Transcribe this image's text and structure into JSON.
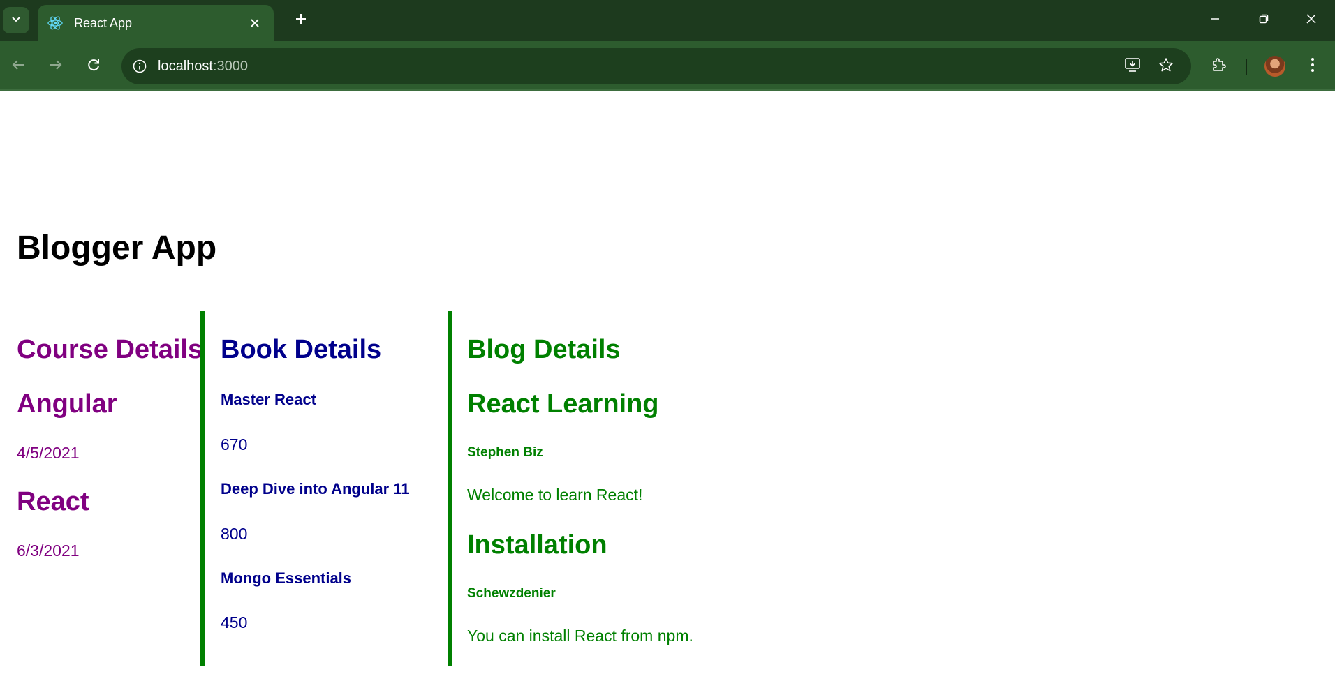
{
  "browser": {
    "tab_title": "React App",
    "url_host": "localhost",
    "url_port": ":3000"
  },
  "app": {
    "title": "Blogger App"
  },
  "course": {
    "heading": "Course Details",
    "color": "#800080",
    "items": [
      {
        "name": "Angular",
        "date": "4/5/2021"
      },
      {
        "name": "React",
        "date": "6/3/2021"
      }
    ]
  },
  "book": {
    "heading": "Book Details",
    "color": "#00008b",
    "items": [
      {
        "name": "Master React",
        "price": "670"
      },
      {
        "name": "Deep Dive into Angular 11",
        "price": "800"
      },
      {
        "name": "Mongo Essentials",
        "price": "450"
      }
    ]
  },
  "blog": {
    "heading": "Blog Details",
    "color": "#008000",
    "items": [
      {
        "title": "React Learning",
        "author": "Stephen Biz",
        "content": "Welcome to learn React!"
      },
      {
        "title": "Installation",
        "author": "Schewzdenier",
        "content": "You can install React from npm."
      }
    ]
  },
  "theme": {
    "chrome_dark": "#1d3a1e",
    "chrome_tab": "#2d5c2e",
    "divider": "#008000"
  }
}
